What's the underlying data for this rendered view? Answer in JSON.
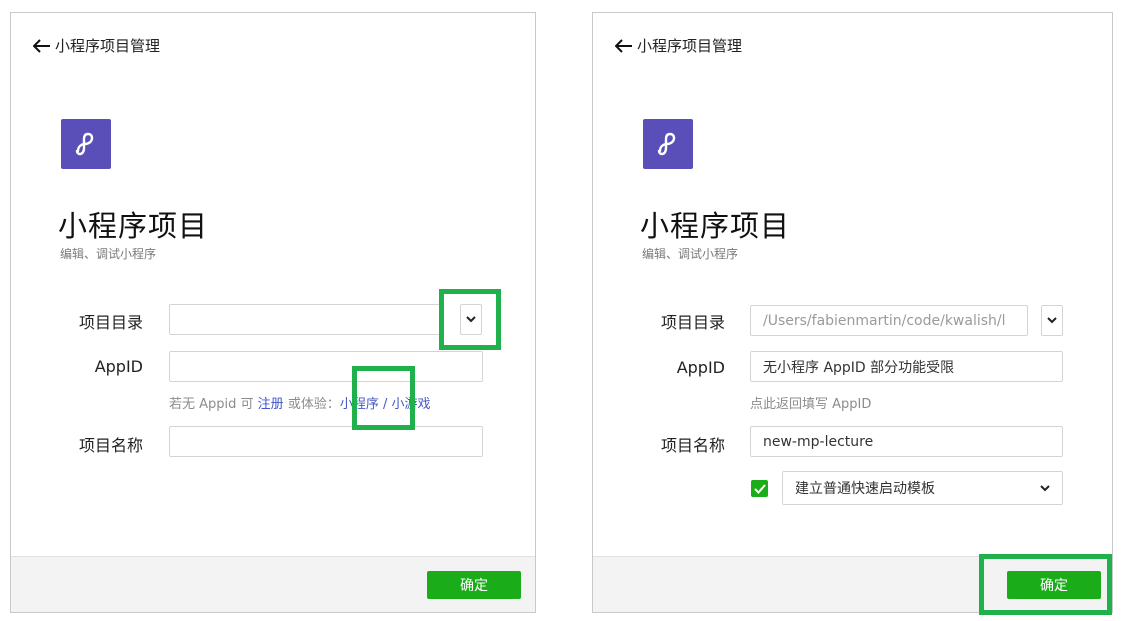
{
  "left_panel": {
    "header": {
      "back_label": "小程序项目管理"
    },
    "title": "小程序项目",
    "subtitle": "编辑、调试小程序",
    "fields": {
      "dir_label": "项目目录",
      "dir_value": "",
      "appid_label": "AppID",
      "appid_value": "",
      "name_label": "项目名称",
      "name_value": ""
    },
    "hint": {
      "prefix": "若无 Appid 可 ",
      "register": "注册",
      "middle": " 或体验：",
      "miniprogram": "小程序",
      "sep": " / ",
      "minigame": "小游戏"
    },
    "confirm_label": "确定"
  },
  "right_panel": {
    "header": {
      "back_label": "小程序项目管理"
    },
    "title": "小程序项目",
    "subtitle": "编辑、调试小程序",
    "fields": {
      "dir_label": "项目目录",
      "dir_value": "/Users/fabienmartin/code/kwalish/l",
      "appid_label": "AppID",
      "appid_value": "无小程序 AppID 部分功能受限",
      "appid_hint": "点此返回填写 AppID",
      "name_label": "项目名称",
      "name_value": "new-mp-lecture",
      "template_value": "建立普通快速启动模板",
      "template_checked": true
    },
    "confirm_label": "确定"
  },
  "colors": {
    "brand_purple": "#5a4fb8",
    "confirm_green": "#1aad19",
    "highlight_green": "#1fb14b",
    "link_blue": "#4257c8"
  }
}
